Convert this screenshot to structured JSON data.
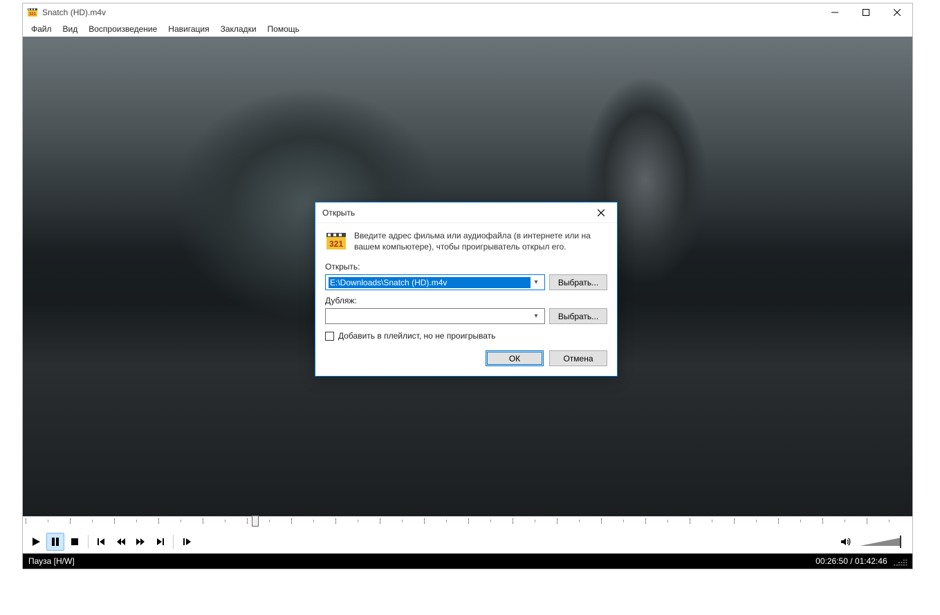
{
  "window": {
    "title": "Snatch (HD).m4v"
  },
  "menubar": {
    "items": [
      "Файл",
      "Вид",
      "Воспроизведение",
      "Навигация",
      "Закладки",
      "Помощь"
    ]
  },
  "seek": {
    "position_percent": 26
  },
  "status": {
    "left": "Пауза [H/W]",
    "time_current": "00:26:50",
    "time_total": "01:42:46",
    "time_sep": " / "
  },
  "dialog": {
    "title": "Открыть",
    "intro": "Введите адрес фильма или аудиофайла (в интернете или на вашем компьютере), чтобы проигрыватель открыл его.",
    "open_label": "Открыть:",
    "open_value": "E:\\Downloads\\Snatch (HD).m4v",
    "dub_label": "Дубляж:",
    "dub_value": "",
    "browse_label": "Выбрать...",
    "checkbox_label": "Добавить в плейлист, но не проигрывать",
    "ok_label": "ОК",
    "cancel_label": "Отмена"
  }
}
